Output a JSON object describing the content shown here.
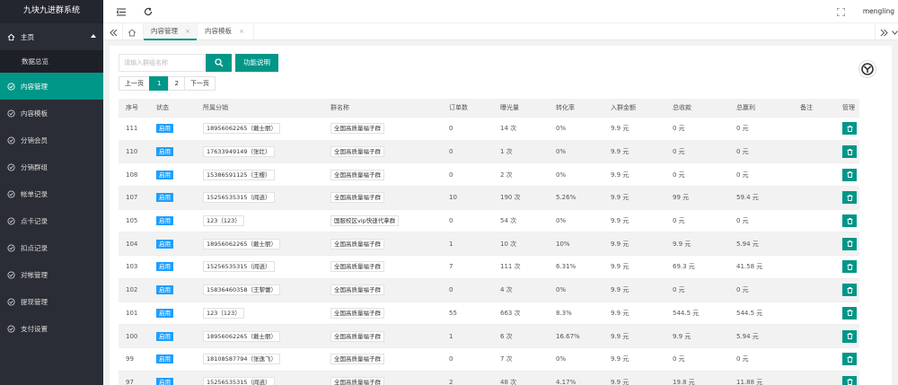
{
  "app": {
    "title": "九块九进群系统"
  },
  "sidebar": {
    "items": [
      {
        "label": "主页",
        "icon": "home-icon"
      },
      {
        "label": "数据总览"
      },
      {
        "label": "内容管理",
        "icon": "check-circle-icon"
      },
      {
        "label": "内容模板",
        "icon": "check-circle-icon"
      },
      {
        "label": "分销会员",
        "icon": "check-circle-icon"
      },
      {
        "label": "分销群组",
        "icon": "check-circle-icon"
      },
      {
        "label": "帐单记录",
        "icon": "check-circle-icon"
      },
      {
        "label": "点卡记录",
        "icon": "check-circle-icon"
      },
      {
        "label": "扣点记录",
        "icon": "check-circle-icon"
      },
      {
        "label": "对帐管理",
        "icon": "check-circle-icon"
      },
      {
        "label": "提现管理",
        "icon": "check-circle-icon"
      },
      {
        "label": "支付设置",
        "icon": "check-circle-icon"
      }
    ]
  },
  "header": {
    "user": "mengling"
  },
  "tabs": [
    {
      "label": "内容管理",
      "close": "×"
    },
    {
      "label": "内容模板",
      "close": "×"
    }
  ],
  "toolbar": {
    "search_placeholder": "请输入群组名称",
    "help_label": "功能说明"
  },
  "pager": {
    "prev": "上一页",
    "page1": "1",
    "page2": "2",
    "next": "下一页"
  },
  "table": {
    "headers": [
      "序号",
      "状态",
      "所属分销",
      "群名称",
      "订单数",
      "曝光量",
      "转化率",
      "入群金额",
      "总收款",
      "总赢利",
      "备注",
      "管理"
    ],
    "rows": [
      {
        "id": "111",
        "status": "启用",
        "dist": "18956062265（戴士丽）",
        "group": "全国高质量福子群",
        "orders": "0",
        "views": "14 次",
        "rate": "0%",
        "price": "9.9 元",
        "income": "0 元",
        "profit": "0 元"
      },
      {
        "id": "110",
        "status": "启用",
        "dist": "17633949149（张灶）",
        "group": "全国高质量福子群",
        "orders": "0",
        "views": "1 次",
        "rate": "0%",
        "price": "9.9 元",
        "income": "0 元",
        "profit": "0 元"
      },
      {
        "id": "108",
        "status": "启用",
        "dist": "15386591125（王樱）",
        "group": "全国高质量福子群",
        "orders": "0",
        "views": "2 次",
        "rate": "0%",
        "price": "9.9 元",
        "income": "0 元",
        "profit": "0 元"
      },
      {
        "id": "107",
        "status": "启用",
        "dist": "15256535315（阎逍）",
        "group": "全国高质量福子群",
        "orders": "10",
        "views": "190 次",
        "rate": "5.26%",
        "price": "9.9 元",
        "income": "99 元",
        "profit": "59.4 元"
      },
      {
        "id": "105",
        "status": "启用",
        "dist": "123（123）",
        "group": "国服校区vip快速代拿群",
        "orders": "0",
        "views": "54 次",
        "rate": "0%",
        "price": "9.9 元",
        "income": "0 元",
        "profit": "0 元"
      },
      {
        "id": "104",
        "status": "启用",
        "dist": "18956062265（戴士丽）",
        "group": "全国高质量福子群",
        "orders": "1",
        "views": "10 次",
        "rate": "10%",
        "price": "9.9 元",
        "income": "9.9 元",
        "profit": "5.94 元"
      },
      {
        "id": "103",
        "status": "启用",
        "dist": "15256535315（阎逍）",
        "group": "全国高质量福子群",
        "orders": "7",
        "views": "111 次",
        "rate": "6.31%",
        "price": "9.9 元",
        "income": "69.3 元",
        "profit": "41.58 元"
      },
      {
        "id": "102",
        "status": "启用",
        "dist": "15836460358（王黎蕾）",
        "group": "全国高质量福子群",
        "orders": "0",
        "views": "4 次",
        "rate": "0%",
        "price": "9.9 元",
        "income": "0 元",
        "profit": "0 元"
      },
      {
        "id": "101",
        "status": "启用",
        "dist": "123（123）",
        "group": "全国高质量福子群",
        "orders": "55",
        "views": "663 次",
        "rate": "8.3%",
        "price": "9.9 元",
        "income": "544.5 元",
        "profit": "544.5 元"
      },
      {
        "id": "100",
        "status": "启用",
        "dist": "18956062265（戴士丽）",
        "group": "全国高质量福子群",
        "orders": "1",
        "views": "6 次",
        "rate": "16.67%",
        "price": "9.9 元",
        "income": "9.9 元",
        "profit": "5.94 元"
      },
      {
        "id": "99",
        "status": "启用",
        "dist": "18108587794（张逸飞）",
        "group": "全国高质量福子群",
        "orders": "0",
        "views": "7 次",
        "rate": "0%",
        "price": "9.9 元",
        "income": "0 元",
        "profit": "0 元"
      },
      {
        "id": "97",
        "status": "启用",
        "dist": "15256535315（阎逍）",
        "group": "全国高质量福子群",
        "orders": "2",
        "views": "48 次",
        "rate": "4.17%",
        "price": "9.9 元",
        "income": "19.8 元",
        "profit": "11.88 元"
      }
    ]
  },
  "colors": {
    "accent": "#009688",
    "sidebar": "#2a2d35",
    "badge": "#1e9fff"
  }
}
